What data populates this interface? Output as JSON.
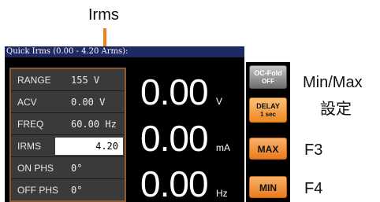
{
  "callouts": {
    "top_label": "Irms",
    "minmax_line1": "Min/Max",
    "minmax_line2": "設定",
    "f3": "F3",
    "f4": "F4"
  },
  "screen": {
    "header": "Quick Irms (0.00 - 4.20 Arms):",
    "params": [
      {
        "label": "RANGE",
        "value": "155 V"
      },
      {
        "label": "ACV",
        "value": "0.00 V"
      },
      {
        "label": "FREQ",
        "value": "60.00 Hz"
      },
      {
        "label": "IRMS",
        "value": "4.20"
      },
      {
        "label": "ON PHS",
        "value": "0°"
      },
      {
        "label": "OFF PHS",
        "value": "0°"
      }
    ],
    "readouts": [
      {
        "value": "0.00",
        "unit": "V"
      },
      {
        "value": "0.00",
        "unit": "mA"
      },
      {
        "value": "0.00",
        "unit": "Hz"
      }
    ]
  },
  "softkeys": {
    "ocfold_title": "OC-Fold",
    "ocfold_sub": "OFF",
    "delay_title": "DELAY",
    "delay_sub": "1 sec",
    "max_label": "MAX",
    "min_label": "MIN"
  },
  "colors": {
    "header_bg": "#1f2a63",
    "accent_orange": "#f07f22",
    "table_border": "#8c5a32"
  }
}
